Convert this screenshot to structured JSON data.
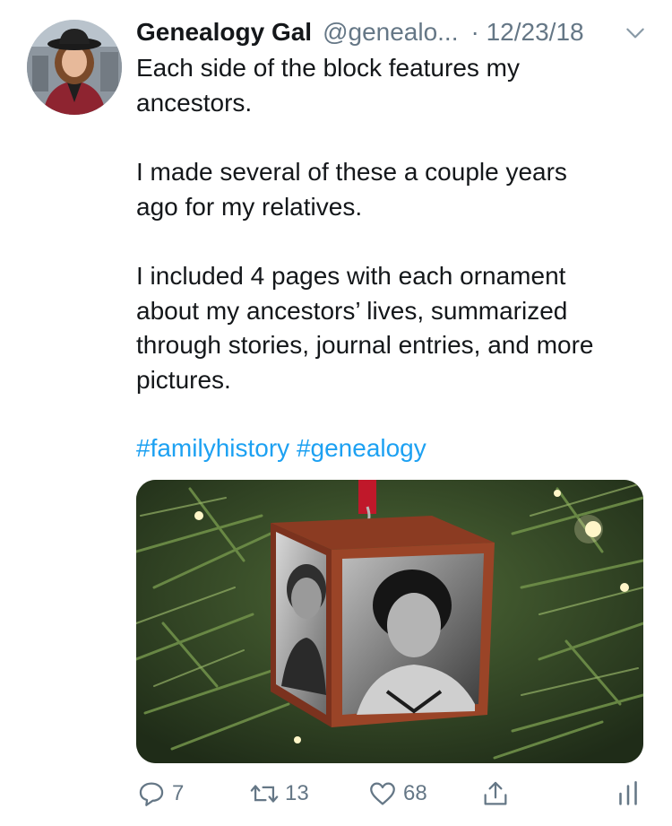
{
  "tweet": {
    "display_name": "Genealogy Gal",
    "handle": "@genealo...",
    "date": "· 12/23/18",
    "paragraphs": [
      [
        "Each side of the block features my",
        "ancestors."
      ],
      [
        "I made several of these a couple years",
        "ago for my relatives."
      ],
      [
        "I included 4 pages with each ornament",
        "about my ancestors’ lives, summarized",
        "through stories, journal entries, and more",
        "pictures."
      ]
    ],
    "hashtags": [
      "#familyhistory",
      "#genealogy"
    ]
  },
  "actions": {
    "reply_count": "7",
    "retweet_count": "13",
    "like_count": "68"
  },
  "icons": {
    "avatar": "profile-photo",
    "chevron": "chevron-down-icon",
    "reply": "reply-icon",
    "retweet": "retweet-icon",
    "like": "heart-icon",
    "share": "share-icon",
    "analytics": "analytics-icon"
  },
  "colors": {
    "text": "#14171a",
    "secondary": "#657786",
    "link": "#1da1f2"
  }
}
